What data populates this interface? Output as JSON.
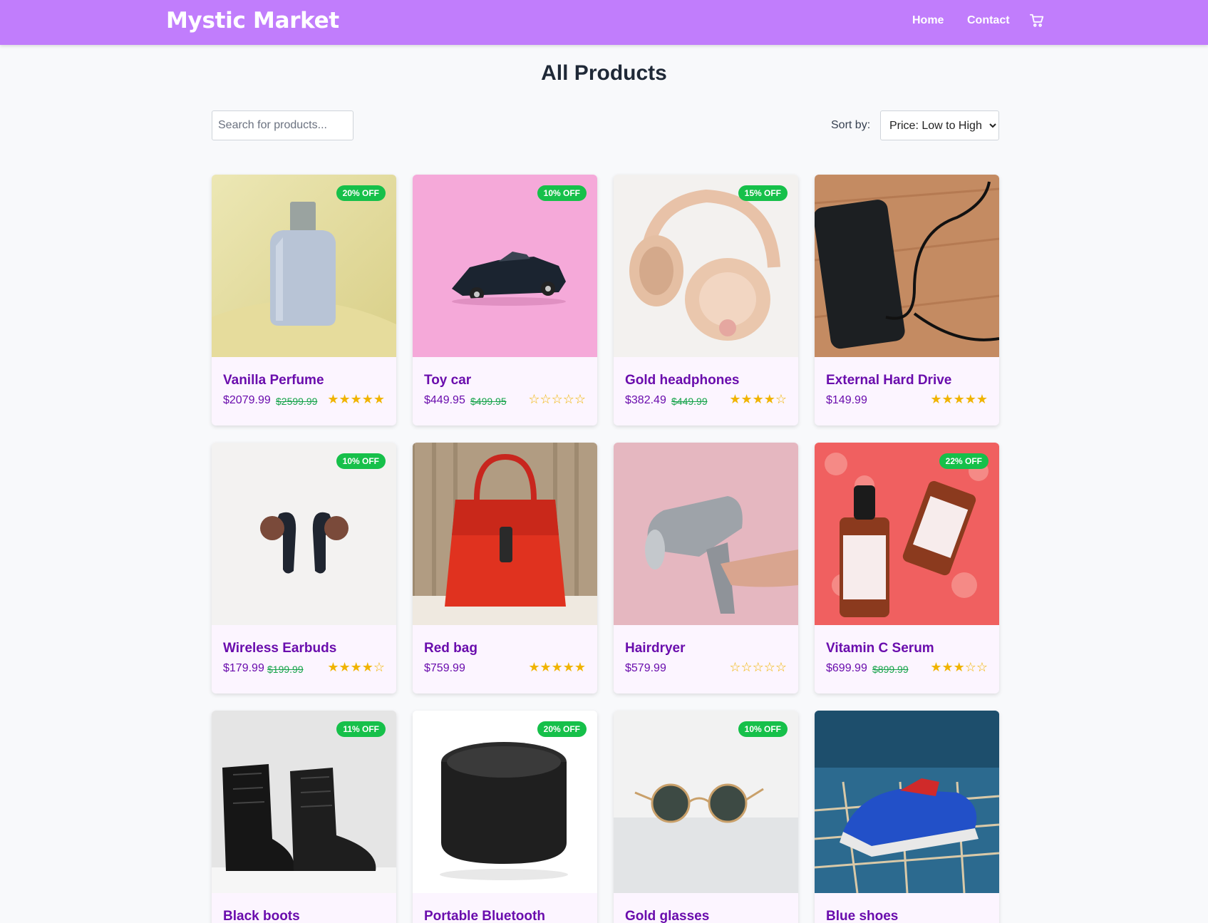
{
  "nav": {
    "brand": "Mystic Market",
    "home": "Home",
    "contact": "Contact"
  },
  "page": {
    "title": "All Products"
  },
  "search": {
    "placeholder": "Search for products..."
  },
  "sort": {
    "label": "Sort by:",
    "selected": "Price: Low to High"
  },
  "colors": {
    "nav_bg": "#c17dfc",
    "title": "#6a0dad",
    "badge": "#16c04a",
    "old_price": "#16a34a",
    "star": "#f0b400"
  },
  "products": [
    {
      "name": "Vanilla Perfume",
      "price": "$2079.99",
      "old_price": "$2599.99",
      "badge": "20% OFF",
      "rating": "★★★★★"
    },
    {
      "name": "Toy car",
      "price": "$449.95",
      "old_price": "$499.95",
      "badge": "10% OFF",
      "rating": "☆☆☆☆☆"
    },
    {
      "name": "Gold headphones",
      "price": "$382.49",
      "old_price": "$449.99",
      "badge": "15% OFF",
      "rating": "★★★★☆"
    },
    {
      "name": "External Hard Drive",
      "price": "$149.99",
      "old_price": "",
      "badge": "",
      "rating": "★★★★★"
    },
    {
      "name": "Wireless Earbuds",
      "price": "$179.99",
      "old_price": "$199.99",
      "badge": "10% OFF",
      "rating": "★★★★☆"
    },
    {
      "name": "Red bag",
      "price": "$759.99",
      "old_price": "",
      "badge": "",
      "rating": "★★★★★"
    },
    {
      "name": "Hairdryer",
      "price": "$579.99",
      "old_price": "",
      "badge": "",
      "rating": "☆☆☆☆☆"
    },
    {
      "name": "Vitamin C Serum",
      "price": "$699.99",
      "old_price": "$899.99",
      "badge": "22% OFF",
      "rating": "★★★☆☆"
    },
    {
      "name": "Black boots",
      "price": "",
      "old_price": "",
      "badge": "11% OFF",
      "rating": ""
    },
    {
      "name": "Portable Bluetooth",
      "price": "",
      "old_price": "",
      "badge": "20% OFF",
      "rating": ""
    },
    {
      "name": "Gold glasses",
      "price": "",
      "old_price": "",
      "badge": "10% OFF",
      "rating": ""
    },
    {
      "name": "Blue shoes",
      "price": "",
      "old_price": "",
      "badge": "",
      "rating": ""
    }
  ]
}
